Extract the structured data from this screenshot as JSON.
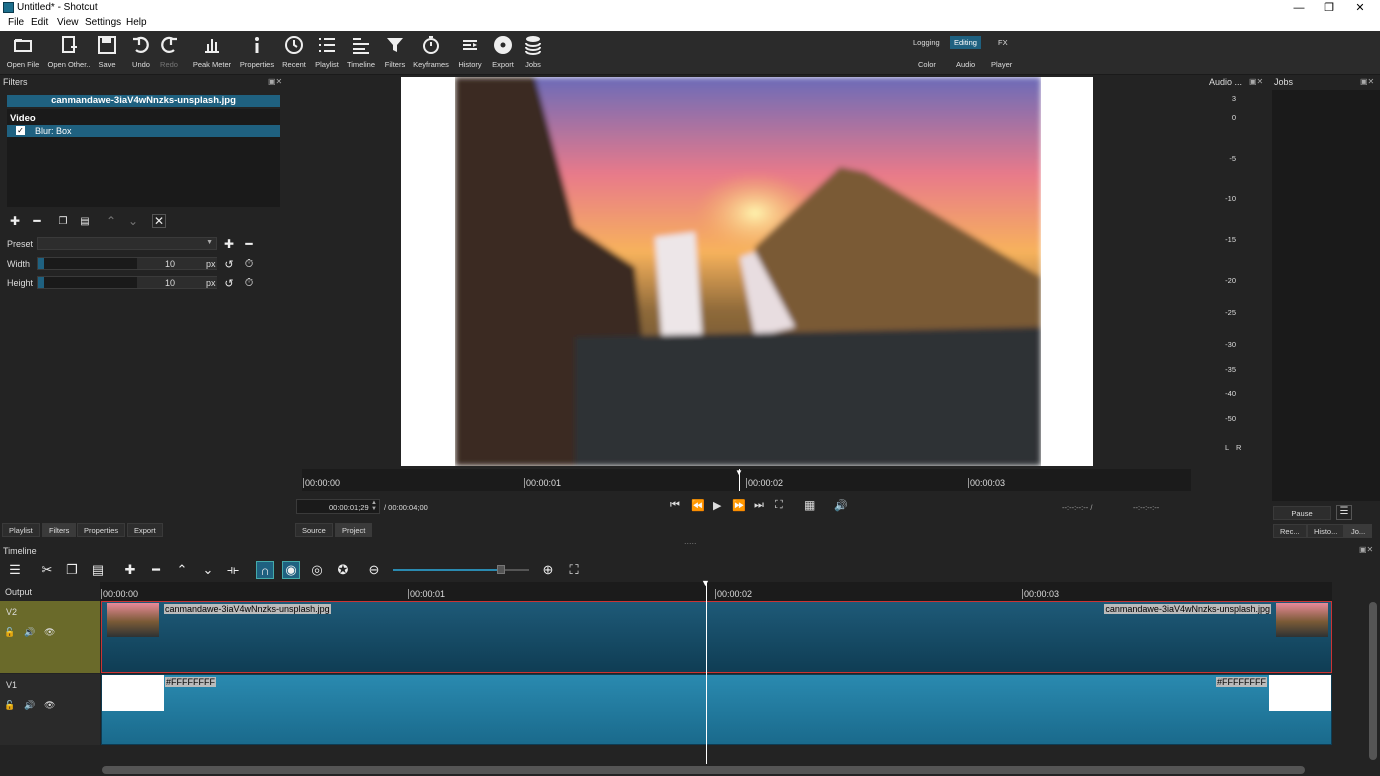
{
  "window": {
    "title": "Untitled* - Shotcut",
    "minimize": "—",
    "maximize": "❐",
    "close": "✕"
  },
  "menu": [
    "File",
    "Edit",
    "View",
    "Settings",
    "Help"
  ],
  "toolbar": {
    "open_file": "Open File",
    "open_other": "Open Other..",
    "save": "Save",
    "undo": "Undo",
    "redo": "Redo",
    "peak_meter": "Peak Meter",
    "properties": "Properties",
    "recent": "Recent",
    "playlist": "Playlist",
    "timeline": "Timeline",
    "filters": "Filters",
    "keyframes": "Keyframes",
    "history": "History",
    "export": "Export",
    "jobs": "Jobs"
  },
  "layouts": {
    "logging": "Logging",
    "editing": "Editing",
    "fx": "FX",
    "color": "Color",
    "audio": "Audio",
    "player": "Player"
  },
  "filters_panel": {
    "title": "Filters",
    "clip_name": "canmandawe-3iaV4wNnzks-unsplash.jpg",
    "section": "Video",
    "filter_item": "Blur: Box",
    "preset_label": "Preset",
    "width_label": "Width",
    "width_value": "10",
    "width_unit": "px",
    "height_label": "Height",
    "height_value": "10",
    "height_unit": "px"
  },
  "left_tabs": [
    "Playlist",
    "Filters",
    "Properties",
    "Export"
  ],
  "player": {
    "ruler": [
      "00:00:00",
      "00:00:01",
      "00:00:02",
      "00:00:03"
    ],
    "current_time": "00:00:01;29",
    "duration": "/ 00:00:04;00",
    "in_point": "--:--:--:-- /",
    "out_point": "--:--:--:--",
    "tabs": {
      "source": "Source",
      "project": "Project"
    }
  },
  "audio_panel": {
    "title": "Audio ...",
    "scale": [
      "3",
      "0",
      "-5",
      "-10",
      "-15",
      "-20",
      "-25",
      "-30",
      "-35",
      "-40",
      "-50"
    ],
    "left": "L",
    "right": "R"
  },
  "jobs_panel": {
    "title": "Jobs",
    "pause": "Pause",
    "tabs": [
      "Rec...",
      "Histo...",
      "Jo..."
    ]
  },
  "timeline": {
    "title": "Timeline",
    "output_label": "Output",
    "ruler": [
      "00:00:00",
      "00:00:01",
      "00:00:02",
      "00:00:03"
    ],
    "tracks": [
      {
        "name": "V2",
        "clip_start_label": "canmandawe-3iaV4wNnzks-unsplash.jpg",
        "clip_end_label": "canmandawe-3iaV4wNnzks-unsplash.jpg"
      },
      {
        "name": "V1",
        "clip_start_label": "#FFFFFFFF",
        "clip_end_label": "#FFFFFFFF"
      }
    ]
  }
}
